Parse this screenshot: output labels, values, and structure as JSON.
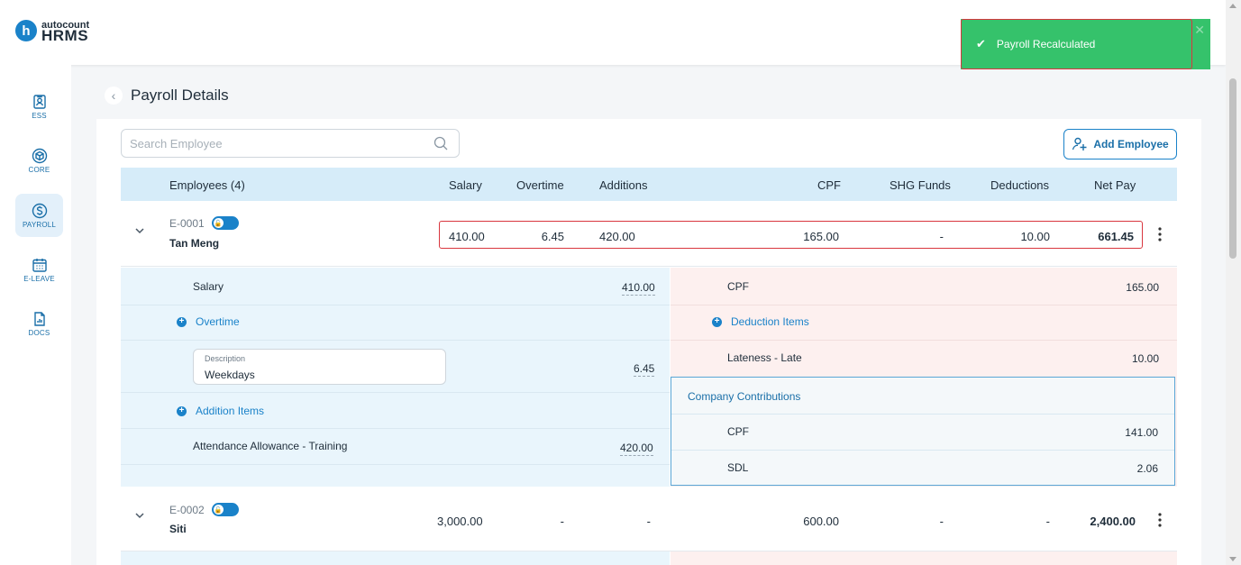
{
  "app": {
    "logo_top": "autocount",
    "logo_bottom": "HRMS",
    "logo_letter": "h"
  },
  "toast": {
    "message": "Payroll Recalculated",
    "close": "✕"
  },
  "sidebar": {
    "items": [
      {
        "label": "ESS",
        "icon": "id-badge-icon"
      },
      {
        "label": "CORE",
        "icon": "cube-icon"
      },
      {
        "label": "PAYROLL",
        "icon": "dollar-circle-icon",
        "active": true
      },
      {
        "label": "E-LEAVE",
        "icon": "calendar-icon"
      },
      {
        "label": "DOCS",
        "icon": "document-chart-icon"
      }
    ]
  },
  "page": {
    "title": "Payroll Details",
    "back": "‹"
  },
  "search": {
    "placeholder": "Search Employee"
  },
  "toolbar": {
    "add_employee_label": "Add Employee"
  },
  "table": {
    "headers": {
      "employees": "Employees (4)",
      "salary": "Salary",
      "overtime": "Overtime",
      "additions": "Additions",
      "cpf": "CPF",
      "shg": "SHG Funds",
      "deductions": "Deductions",
      "net_pay": "Net Pay"
    },
    "rows": [
      {
        "code": "E-0001",
        "name": "Tan Meng",
        "salary": "410.00",
        "overtime": "6.45",
        "additions": "420.00",
        "cpf": "165.00",
        "shg": "-",
        "deductions": "10.00",
        "net_pay": "661.45"
      },
      {
        "code": "E-0002",
        "name": "Siti",
        "salary": "3,000.00",
        "overtime": "-",
        "additions": "-",
        "cpf": "600.00",
        "shg": "-",
        "deductions": "-",
        "net_pay": "2,400.00"
      }
    ]
  },
  "details": {
    "salary_label": "Salary",
    "salary_value": "410.00",
    "overtime_label": "Overtime",
    "overtime_desc_label": "Description",
    "overtime_desc_value": "Weekdays",
    "overtime_value": "6.45",
    "addition_label": "Addition Items",
    "addition_item_label": "Attendance Allowance - Training",
    "addition_item_value": "420.00",
    "cpf_label": "CPF",
    "cpf_value": "165.00",
    "deduction_label": "Deduction Items",
    "lateness_label": "Lateness - Late",
    "lateness_value": "10.00",
    "company_title": "Company Contributions",
    "company_cpf_label": "CPF",
    "company_cpf_value": "141.00",
    "company_sdl_label": "SDL",
    "company_sdl_value": "2.06"
  },
  "colors": {
    "accent": "#1a82c9",
    "toast": "#35c26b",
    "highlight": "#d9363e"
  }
}
